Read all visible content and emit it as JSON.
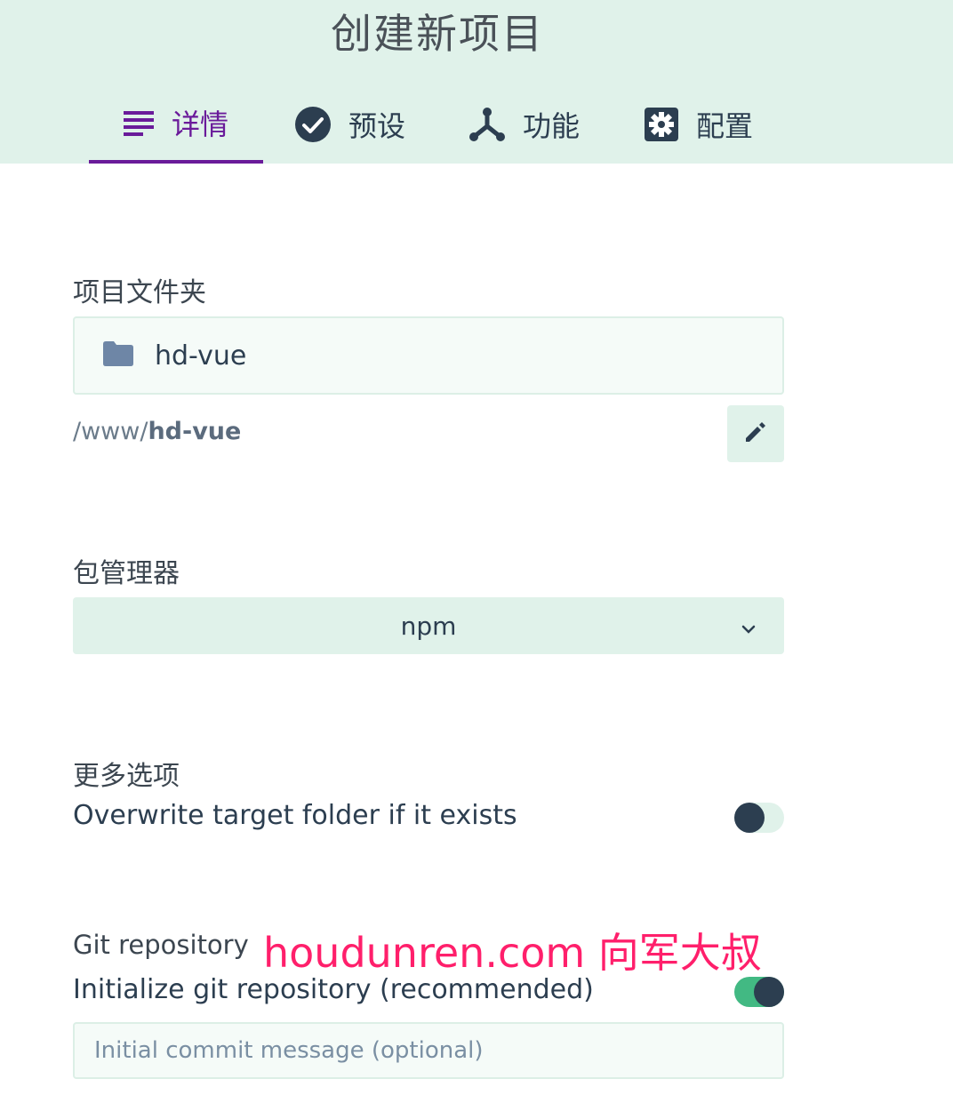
{
  "header": {
    "title": "创建新项目",
    "tabs": [
      {
        "label": "详情",
        "icon": "list-icon",
        "active": true
      },
      {
        "label": "预设",
        "icon": "check-circle-icon",
        "active": false
      },
      {
        "label": "功能",
        "icon": "fork-icon",
        "active": false
      },
      {
        "label": "配置",
        "icon": "gear-icon",
        "active": false
      }
    ]
  },
  "folder": {
    "label": "项目文件夹",
    "value": "hd-vue",
    "path_prefix": "/www/",
    "path_name": "hd-vue"
  },
  "package_manager": {
    "label": "包管理器",
    "selected": "npm"
  },
  "more_options": {
    "label": "更多选项",
    "overwrite_label": "Overwrite target folder if it exists",
    "overwrite_enabled": false
  },
  "git": {
    "label": "Git repository",
    "init_label": "Initialize git repository (recommended)",
    "init_enabled": true,
    "commit_placeholder": "Initial commit message (optional)"
  },
  "watermark": "houdunren.com 向军大叔",
  "colors": {
    "accent": "#6a1b9a",
    "header_bg": "#e0f2ea",
    "toggle_on": "#42b983",
    "watermark": "#ff1f6b"
  }
}
